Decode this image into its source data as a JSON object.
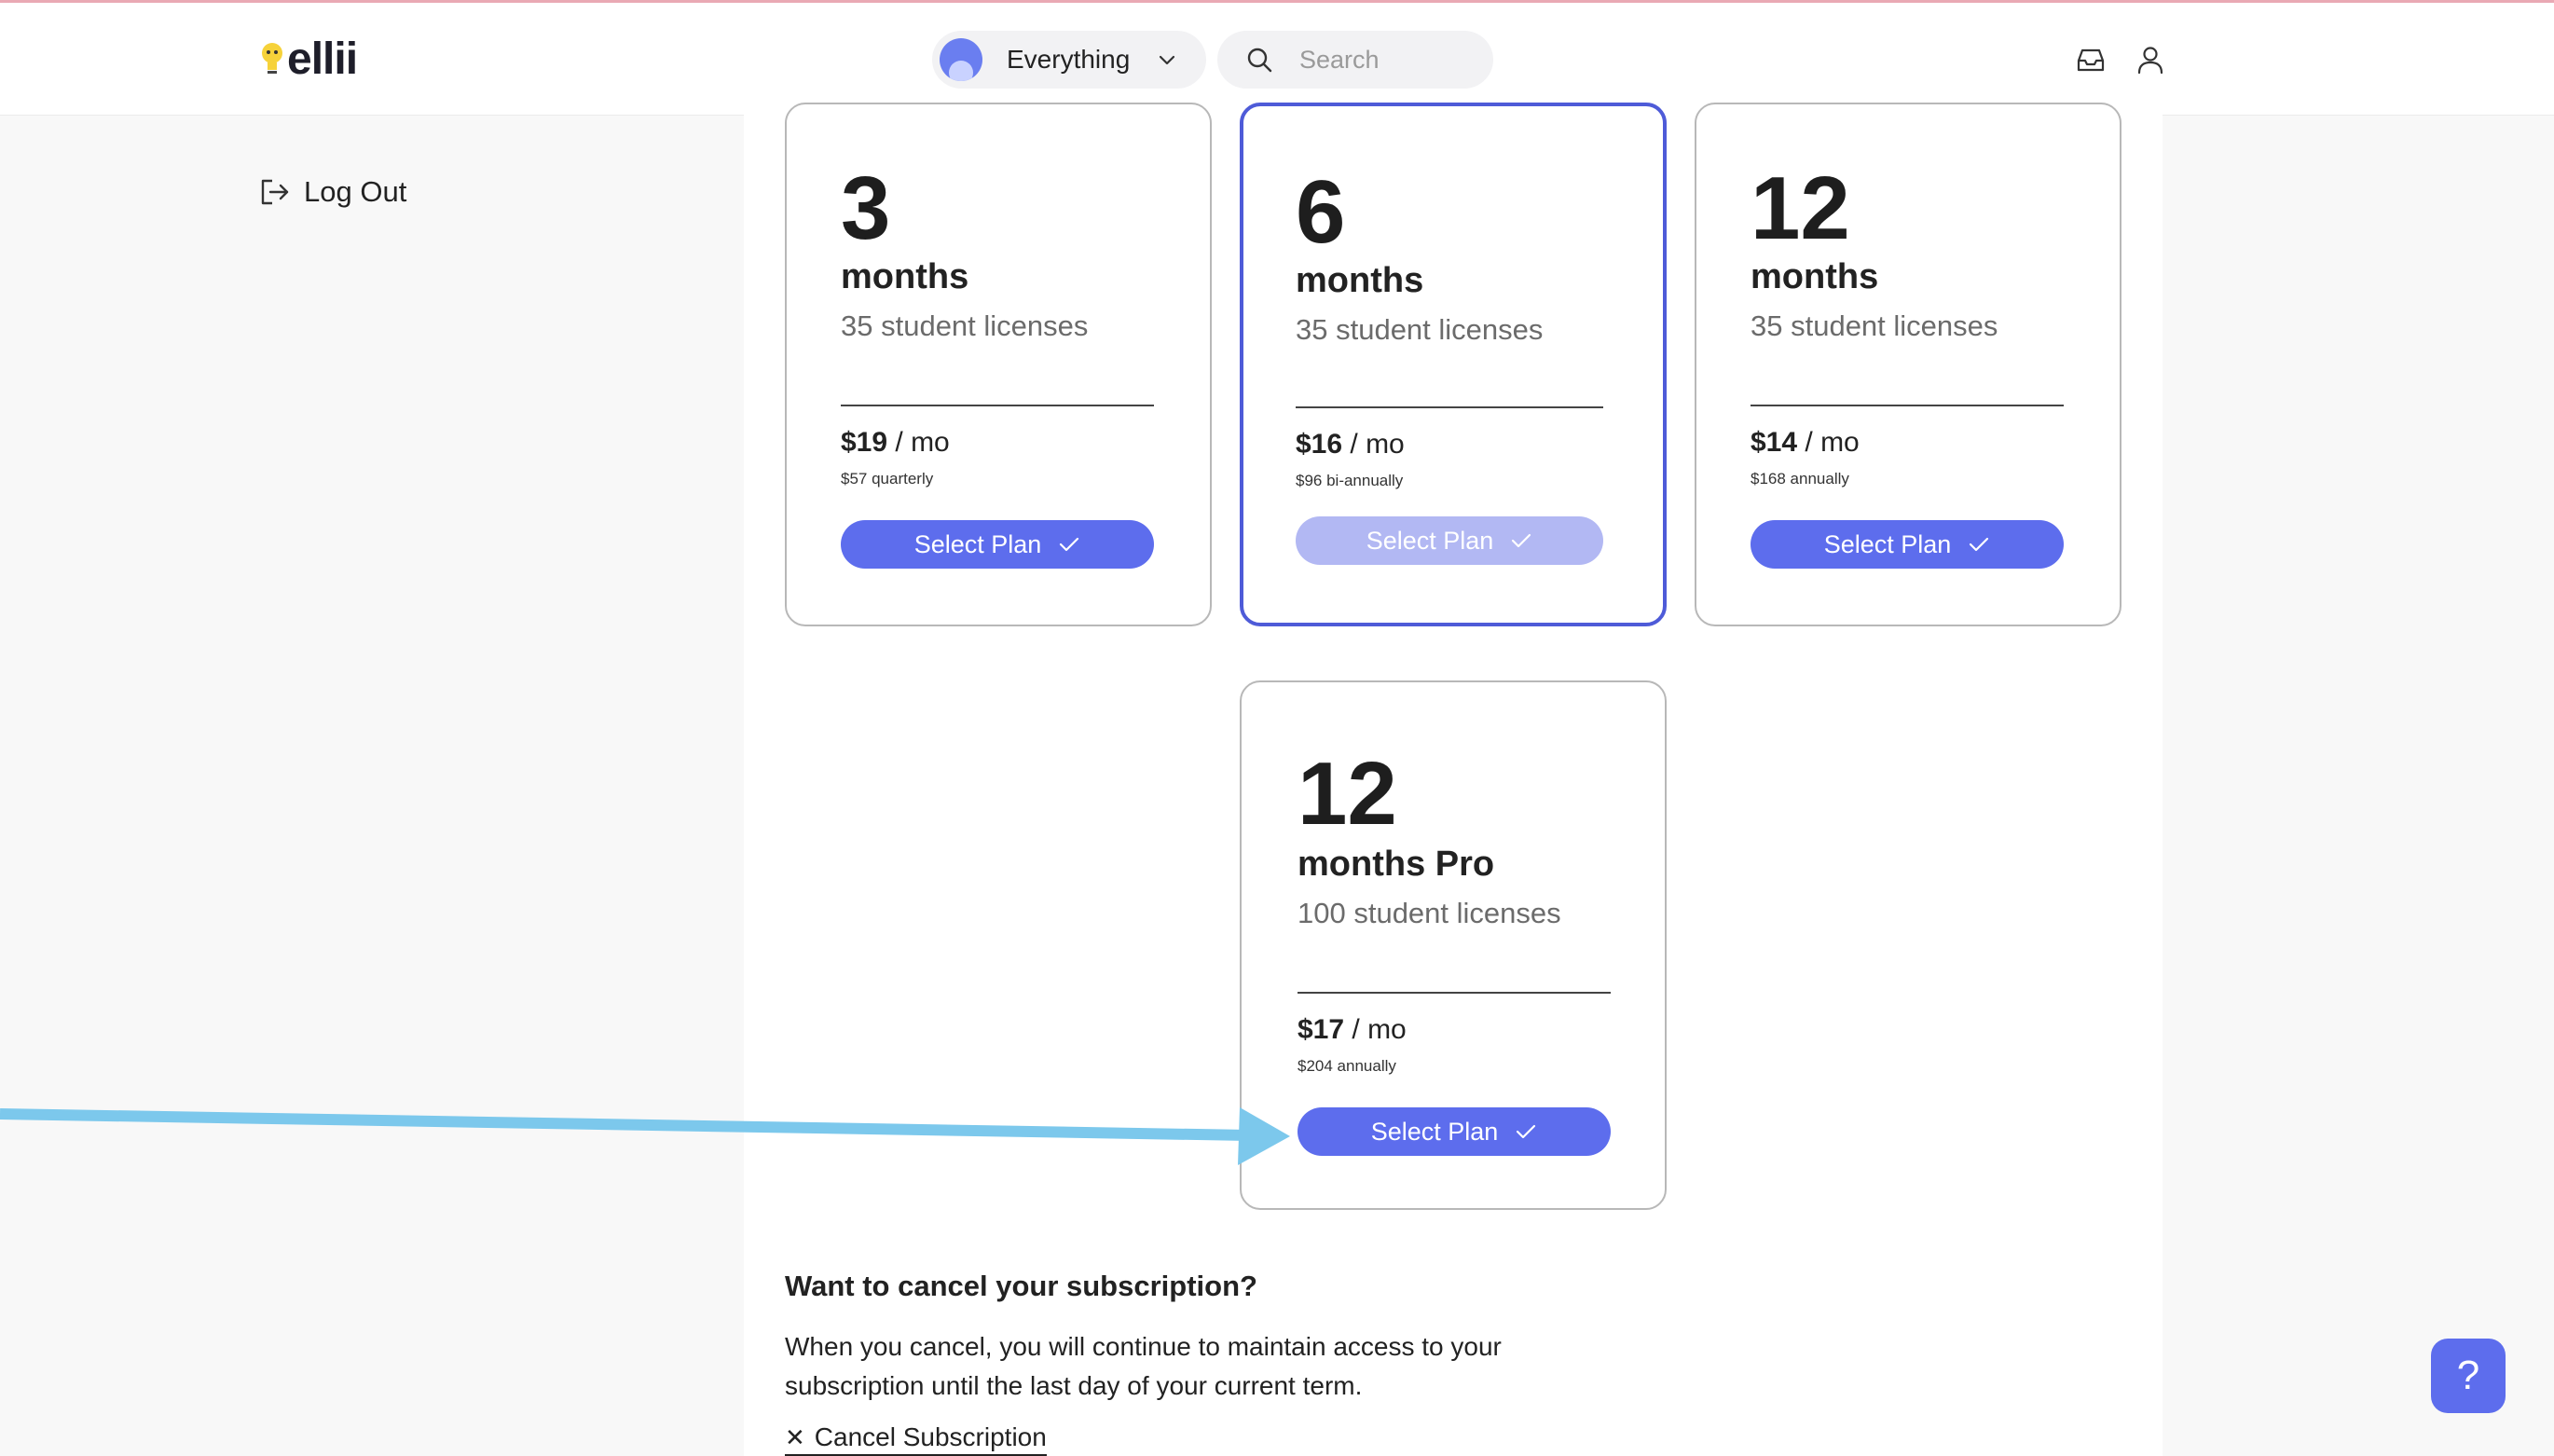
{
  "header": {
    "logo_text": "ellii",
    "scope_label": "Everything",
    "search_placeholder": "Search"
  },
  "sidebar": {
    "logout_label": "Log Out"
  },
  "plans": [
    {
      "number": "3",
      "term": "months",
      "licenses": "35 student licenses",
      "price": "$19",
      "per": " / mo",
      "billing": "$57 quarterly",
      "button": "Select Plan",
      "current": false
    },
    {
      "number": "6",
      "term": "months",
      "licenses": "35 student licenses",
      "price": "$16",
      "per": " / mo",
      "billing": "$96 bi-annually",
      "button": "Select Plan",
      "current": true
    },
    {
      "number": "12",
      "term": "months",
      "licenses": "35 student licenses",
      "price": "$14",
      "per": " / mo",
      "billing": "$168 annually",
      "button": "Select Plan",
      "current": false
    },
    {
      "number": "12",
      "term": "months Pro",
      "licenses": "100 student licenses",
      "price": "$17",
      "per": " / mo",
      "billing": "$204 annually",
      "button": "Select Plan",
      "current": false
    }
  ],
  "cancel": {
    "title": "Want to cancel your subscription?",
    "text": "When you cancel, you will continue to maintain access to your subscription until the last day of your current term.",
    "link": "Cancel Subscription"
  },
  "help": {
    "label": "?"
  },
  "colors": {
    "accent": "#5d6ded",
    "accent_disabled": "#b2b8f3",
    "current_border": "#4e5bd8",
    "annotation_arrow": "#7cc8ec"
  }
}
